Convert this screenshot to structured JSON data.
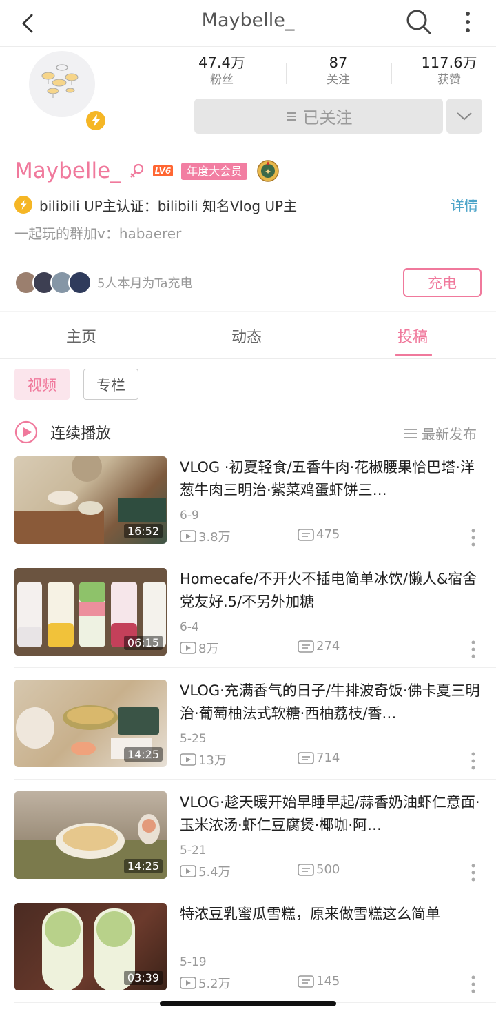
{
  "header": {
    "title": "Maybelle_"
  },
  "stats": [
    {
      "value": "47.4万",
      "label": "粉丝"
    },
    {
      "value": "87",
      "label": "关注"
    },
    {
      "value": "117.6万",
      "label": "获赞"
    }
  ],
  "follow": {
    "label": "已关注"
  },
  "profile": {
    "name": "Maybelle_",
    "level": "LV6",
    "vip": "年度大会员",
    "verify": "bilibili  UP主认证：bilibili  知名Vlog  UP主",
    "detail": "详情",
    "bio": "一起玩的群加v：habaerer",
    "fans_text": "5人本月为Ta充电",
    "charge_label": "充电"
  },
  "tabs": [
    {
      "label": "主页",
      "active": false
    },
    {
      "label": "动态",
      "active": false
    },
    {
      "label": "投稿",
      "active": true
    }
  ],
  "subtabs": [
    {
      "label": "视频",
      "active": true
    },
    {
      "label": "专栏",
      "active": false
    }
  ],
  "playlist": {
    "continuous": "连续播放",
    "sort": "最新发布"
  },
  "videos": [
    {
      "title": "VLOG ·初夏轻食/五香牛肉·花椒腰果恰巴塔·洋葱牛肉三明治·紫菜鸡蛋虾饼三…",
      "date": "6-9",
      "views": "3.8万",
      "danmu": "475",
      "duration": "16:52"
    },
    {
      "title": "Homecafe/不开火不插电简单冰饮/懒人&宿舍党友好.5/不另外加糖",
      "date": "6-4",
      "views": "8万",
      "danmu": "274",
      "duration": "06:15"
    },
    {
      "title": "VLOG·充满香气的日子/牛排波奇饭·佛卡夏三明治·葡萄柚法式软糖·西柚荔枝/香…",
      "date": "5-25",
      "views": "13万",
      "danmu": "714",
      "duration": "14:25"
    },
    {
      "title": "VLOG·趁天暖开始早睡早起/蒜香奶油虾仁意面·玉米浓汤·虾仁豆腐煲·椰咖·阿…",
      "date": "5-21",
      "views": "5.4万",
      "danmu": "500",
      "duration": "14:25"
    },
    {
      "title": "特浓豆乳蜜瓜雪糕，原来做雪糕这么简单",
      "date": "5-19",
      "views": "5.2万",
      "danmu": "145",
      "duration": "03:39"
    }
  ],
  "colors": {
    "accent": "#f0799c",
    "link": "#4aa3c8",
    "badge_gold": "#f5b625"
  }
}
